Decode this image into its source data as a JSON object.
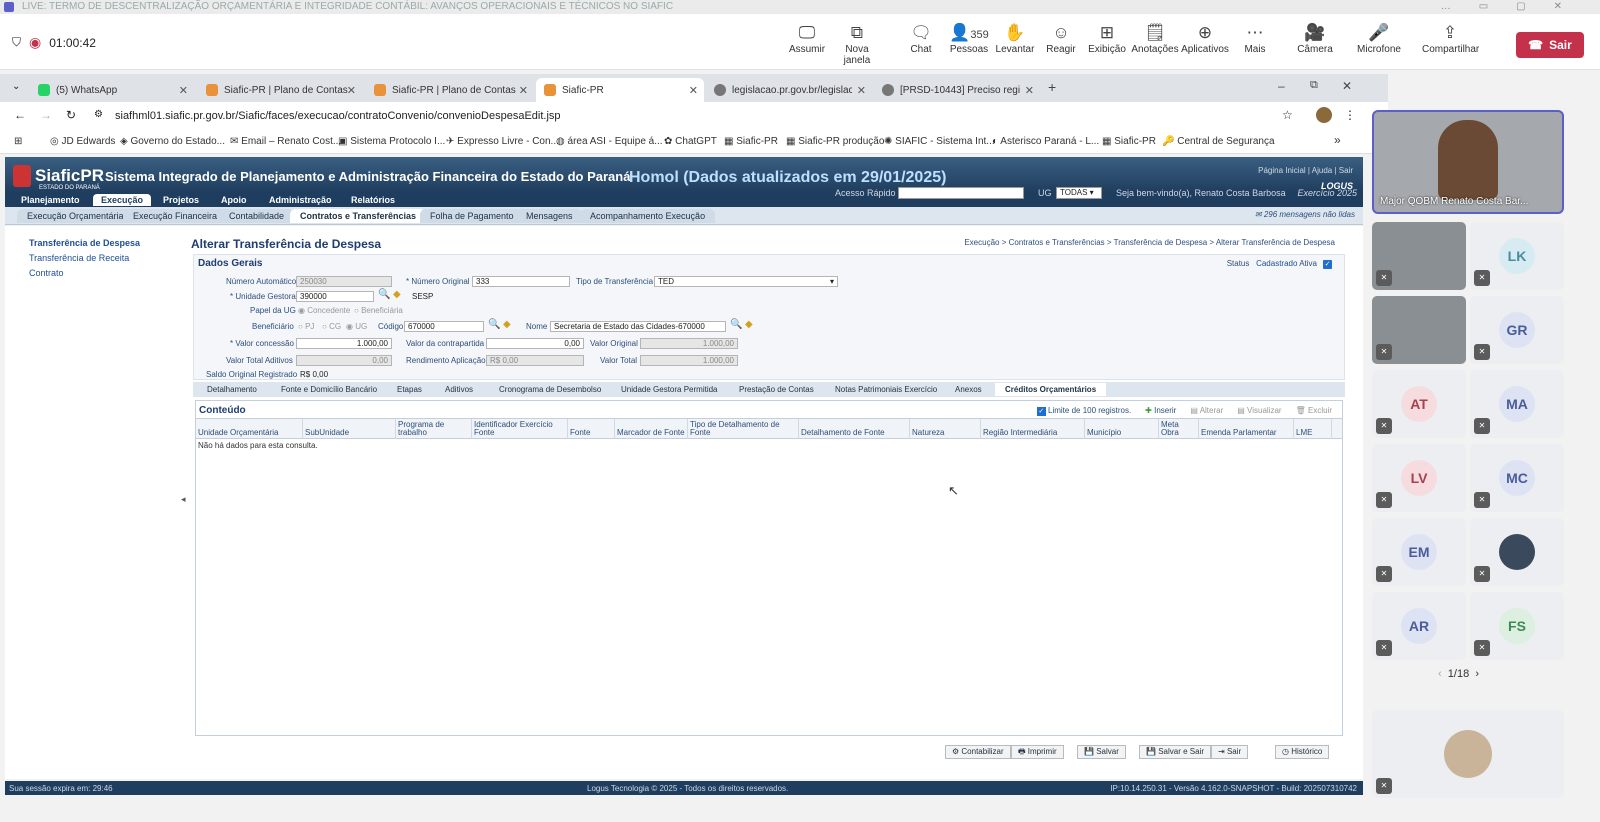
{
  "teams": {
    "title": "LIVE: TERMO DE DESCENTRALIZAÇÃO ORÇAMENTÁRIA E INTEGRIDADE CONTÁBIL: AVANÇOS OPERACIONAIS E TÉCNICOS NO SIAFIC",
    "timer": "01:00:42",
    "people_count": "359",
    "tools": [
      "Assumir",
      "Nova janela",
      "Chat",
      "Pessoas",
      "Levantar",
      "Reagir",
      "Exibição",
      "Anotações",
      "Aplicativos",
      "Mais",
      "Câmera",
      "Microfone",
      "Compartilhar"
    ],
    "leave": "Sair"
  },
  "browser": {
    "tabs": [
      "(5) WhatsApp",
      "Siafic-PR | Plano de Contas",
      "Siafic-PR | Plano de Contas",
      "Siafic-PR",
      "legislacao.pr.gov.br/legislacao/p",
      "[PRSD-10443] Preciso registrar"
    ],
    "url": "siafhml01.siafic.pr.gov.br/Siafic/faces/execucao/contratoConvenio/convenioDespesaEdit.jsp",
    "bookmarks": [
      "JD Edwards",
      "Governo do Estado...",
      "Email – Renato Cost...",
      "Sistema Protocolo I...",
      "Expresso Livre - Con...",
      "área ASI - Equipe á...",
      "ChatGPT",
      "Siafic-PR",
      "Siafic-PR produção",
      "SIAFIC - Sistema Int...",
      "Asterisco Paraná - L...",
      "Siafic-PR",
      "Central de Segurança"
    ]
  },
  "siafic": {
    "logo": "SiaficPR",
    "logo_sub": "ESTADO DO PARANÁ",
    "system_title": "Sistema Integrado de Planejamento e Administração Financeira do Estado do Paraná",
    "homol": "Homol (Dados atualizados em 29/01/2025)",
    "head_links": "Página Inicial  |  Ajuda  |  Sair",
    "logus": "LOGUS",
    "menu": [
      "Planejamento",
      "Execução",
      "Projetos",
      "Apoio",
      "Administração",
      "Relatórios"
    ],
    "acesso_rapido": "Acesso Rápido",
    "ug_label": "UG",
    "ug_value": "TODAS",
    "welcome": "Seja bem-vindo(a), Renato Costa Barbosa",
    "exercicio": "Exercício 2025",
    "submenu": [
      "Execução Orçamentária",
      "Execução Financeira",
      "Contabilidade",
      "Contratos e Transferências",
      "Folha de Pagamento",
      "Mensagens",
      "Acompanhamento Execução"
    ],
    "messages": "296 mensagens não lidas",
    "leftnav": [
      "Transferência de Despesa",
      "Transferência de Receita",
      "Contrato"
    ],
    "page_title": "Alterar Transferência de Despesa",
    "breadcrumb": "Execução > Contratos e Transferências > Transferência de Despesa > Alterar Transferência de Despesa",
    "dados_title": "Dados Gerais",
    "status_label": "Status",
    "status_value": "Cadastrado",
    "ativa": "Ativa",
    "form": {
      "numero_automatico_l": "Número Automático",
      "numero_automatico": "250030",
      "numero_original_l": "* Número Original",
      "numero_original": "333",
      "tipo_transf_l": "Tipo de Transferência",
      "tipo_transf": "TED",
      "unidade_gestora_l": "* Unidade Gestora",
      "unidade_gestora": "390000",
      "ug_sigla": "SESP",
      "papel_ug_l": "Papel da UG",
      "concedente": "Concedente",
      "beneficiaria": "Beneficiária",
      "beneficiario_l": "Beneficiário",
      "pj": "PJ",
      "cg": "CG",
      "ug": "UG",
      "codigo_l": "Código",
      "codigo": "670000",
      "nome_l": "Nome",
      "nome": "Secretaria de Estado das Cidades-670000",
      "valor_concessao_l": "* Valor concessão",
      "valor_concessao": "1.000,00",
      "valor_contrapartida_l": "Valor da contrapartida",
      "valor_contrapartida": "0,00",
      "valor_original_l": "Valor Original",
      "valor_original": "1.000,00",
      "valor_aditivos_l": "Valor Total Aditivos",
      "valor_aditivos": "0,00",
      "rendimento_l": "Rendimento Aplicação",
      "rendimento": "R$ 0,00",
      "valor_total_l": "Valor Total",
      "valor_total": "1.000,00",
      "saldo_l": "Saldo Original Registrado",
      "saldo": "R$ 0,00"
    },
    "subtabs": [
      "Detalhamento",
      "Fonte e Domicílio Bancário",
      "Etapas",
      "Aditivos",
      "Cronograma de Desembolso",
      "Unidade Gestora Permitida",
      "Prestação de Contas",
      "Notas Patrimoniais Exercício",
      "Anexos",
      "Créditos Orçamentários"
    ],
    "panel_title": "Conteúdo",
    "limit": "Limite de 100 registros.",
    "actions": [
      "Inserir",
      "Alterar",
      "Visualizar",
      "Excluir"
    ],
    "columns": [
      "Unidade Orçamentária",
      "SubUnidade",
      "Programa de trabalho",
      "Identificador Exercício Fonte",
      "Fonte",
      "Marcador de Fonte",
      "Tipo de Detalhamento de Fonte",
      "Detalhamento de Fonte",
      "Natureza",
      "Região Intermediária",
      "Município",
      "Meta Obra",
      "Emenda Parlamentar",
      "LME"
    ],
    "nodata": "Não há dados para esta consulta.",
    "buttons": [
      "Contabilizar",
      "Imprimir",
      "Salvar",
      "Salvar e Sair",
      "Sair",
      "Histórico"
    ],
    "footer_left": "Sua sessão expira em: 29:46",
    "footer_center": "Logus Tecnologia © 2025 - Todos os direitos reservados.",
    "footer_right": "IP:10.14.250.31 - Versão 4.162.0-SNAPSHOT - Build: 202507310742"
  },
  "participants": {
    "main_name": "Major QOBM Renato Costa Bar...",
    "tiles": [
      "LK",
      "GR",
      "AT",
      "MA",
      "LV",
      "MC",
      "EM",
      "AR",
      "FS"
    ],
    "pager": "1/18"
  }
}
